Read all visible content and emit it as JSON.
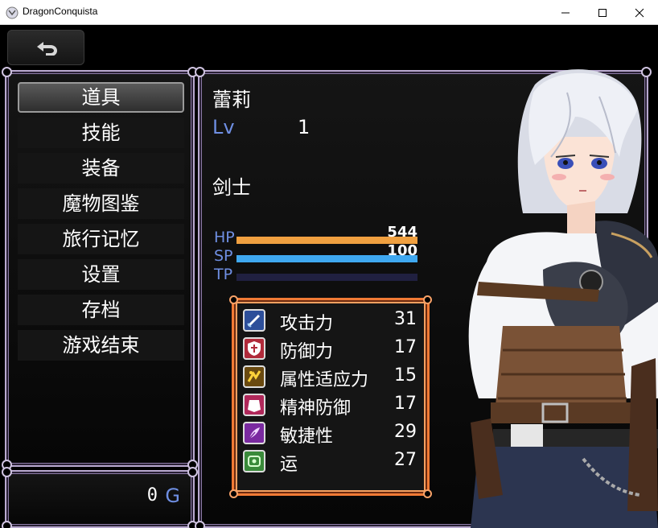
{
  "window": {
    "title": "DragonConquista"
  },
  "gold": {
    "value": "0",
    "unit": "G"
  },
  "menu": [
    {
      "id": "items",
      "label": "道具"
    },
    {
      "id": "skills",
      "label": "技能"
    },
    {
      "id": "equip",
      "label": "装备"
    },
    {
      "id": "monster-book",
      "label": "魔物图鉴"
    },
    {
      "id": "memories",
      "label": "旅行记忆"
    },
    {
      "id": "settings",
      "label": "设置"
    },
    {
      "id": "save",
      "label": "存档"
    },
    {
      "id": "game-end",
      "label": "游戏结束"
    }
  ],
  "actor": {
    "name": "蕾莉",
    "level_label": "Lv",
    "level": "1",
    "class": "剑士",
    "hp": {
      "label": "HP",
      "value": "544",
      "fill": 1.0
    },
    "sp": {
      "label": "SP",
      "value": "100",
      "fill": 1.0
    },
    "tp": {
      "label": "TP",
      "value": "",
      "fill": 0.0
    }
  },
  "params": [
    {
      "icon": "sword-icon",
      "name": "攻击力",
      "value": "31"
    },
    {
      "icon": "shield-icon",
      "name": "防御力",
      "value": "17"
    },
    {
      "icon": "element-adapt-icon",
      "name": "属性适应力",
      "value": "15"
    },
    {
      "icon": "spirit-defense-icon",
      "name": "精神防御",
      "value": "17"
    },
    {
      "icon": "feather-icon",
      "name": "敏捷性",
      "value": "29"
    },
    {
      "icon": "luck-icon",
      "name": "运",
      "value": "27"
    }
  ],
  "colors": {
    "hp_gauge": "#f0a040",
    "sp_gauge": "#3fa8f0",
    "system_label": "#6f8fe3",
    "param_frame": "#f17a35"
  }
}
